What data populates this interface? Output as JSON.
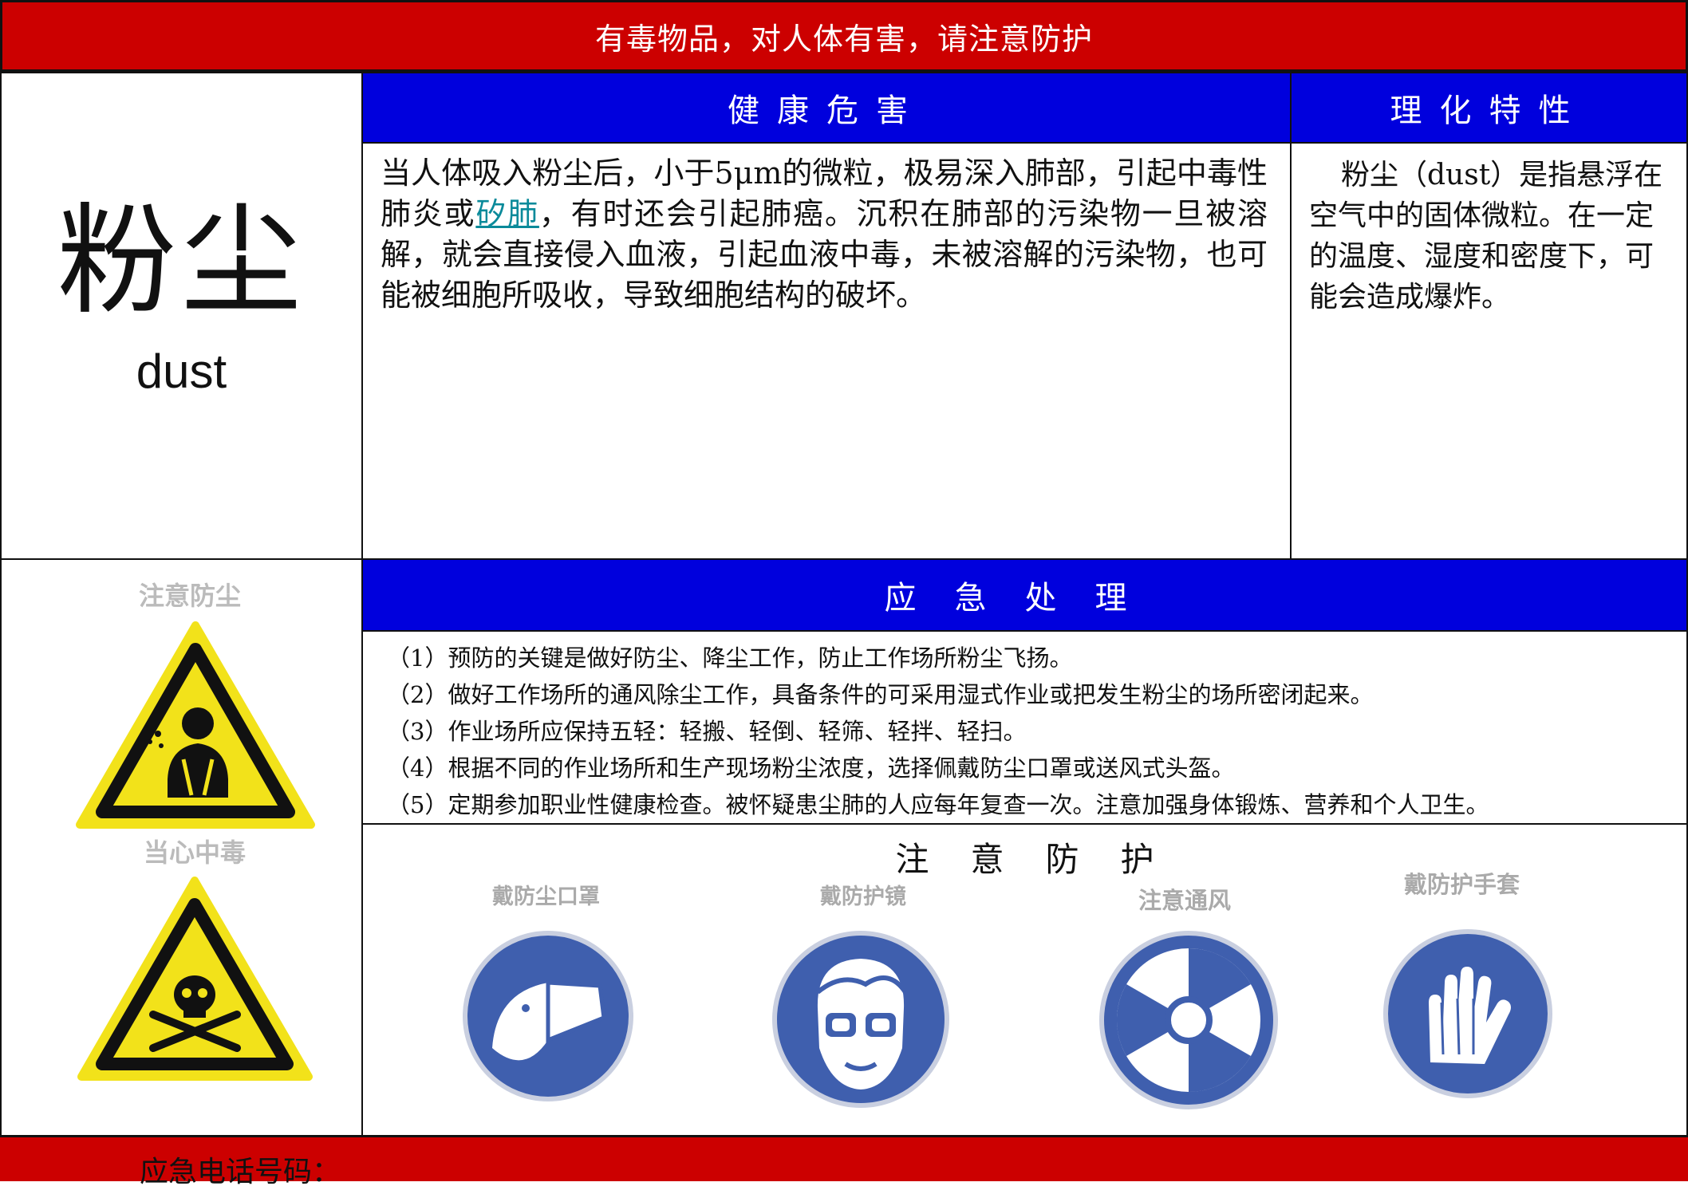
{
  "header": {
    "banner": "有毒物品，对人体有害，请注意防护"
  },
  "substance": {
    "name_cn": "粉尘",
    "name_en": "dust"
  },
  "health": {
    "title": "健康危害",
    "text_before_link": "当人体吸入粉尘后，小于5μm的微粒，极易深入肺部，引起中毒性肺炎或",
    "link_text": "矽肺",
    "text_after_link": "，有时还会引起肺癌。沉积在肺部的污染物一旦被溶解，就会直接侵入血液，引起血液中毒，未被溶解的污染物，也可能被细胞所吸收，导致细胞结构的破坏。"
  },
  "properties": {
    "title": "理化特性",
    "text": "粉尘（dust）是指悬浮在空气中的固体微粒。在一定的温度、湿度和密度下，可能会造成爆炸。"
  },
  "warning_signs": [
    {
      "label": "注意防尘",
      "icon": "dust-inhalation-warning-icon",
      "color": "#f2e21a"
    },
    {
      "label": "当心中毒",
      "icon": "poison-skull-warning-icon",
      "color": "#f2e21a"
    }
  ],
  "emergency": {
    "title": "应急处理",
    "items": [
      "（1）预防的关键是做好防尘、降尘工作，防止工作场所粉尘飞扬。",
      "（2）做好工作场所的通风除尘工作，具备条件的可采用湿式作业或把发生粉尘的场所密闭起来。",
      "（3）作业场所应保持五轻：轻搬、轻倒、轻筛、轻拌、轻扫。",
      "（4）根据不同的作业场所和生产现场粉尘浓度，选择佩戴防尘口罩或送风式头盔。",
      "（5）定期参加职业性健康检查。被怀疑患尘肺的人应每年复查一次。注意加强身体锻炼、营养和个人卫生。"
    ]
  },
  "protection": {
    "title": "注意防护",
    "signs": [
      {
        "label": "戴防尘口罩",
        "icon": "dust-mask-icon",
        "color": "#3f5fae"
      },
      {
        "label": "戴防护镜",
        "icon": "goggles-icon",
        "color": "#3f5fae"
      },
      {
        "label": "注意通风",
        "icon": "ventilation-fan-icon",
        "color": "#3f5fae"
      },
      {
        "label": "戴防护手套",
        "icon": "protective-gloves-icon",
        "color": "#3f5fae"
      }
    ]
  },
  "footer": {
    "phone_label": "应急电话号码："
  },
  "colors": {
    "red": "#cc0000",
    "blue": "#0000dd",
    "warning_yellow": "#f2e21a",
    "mandatory_blue": "#3f5fae"
  }
}
